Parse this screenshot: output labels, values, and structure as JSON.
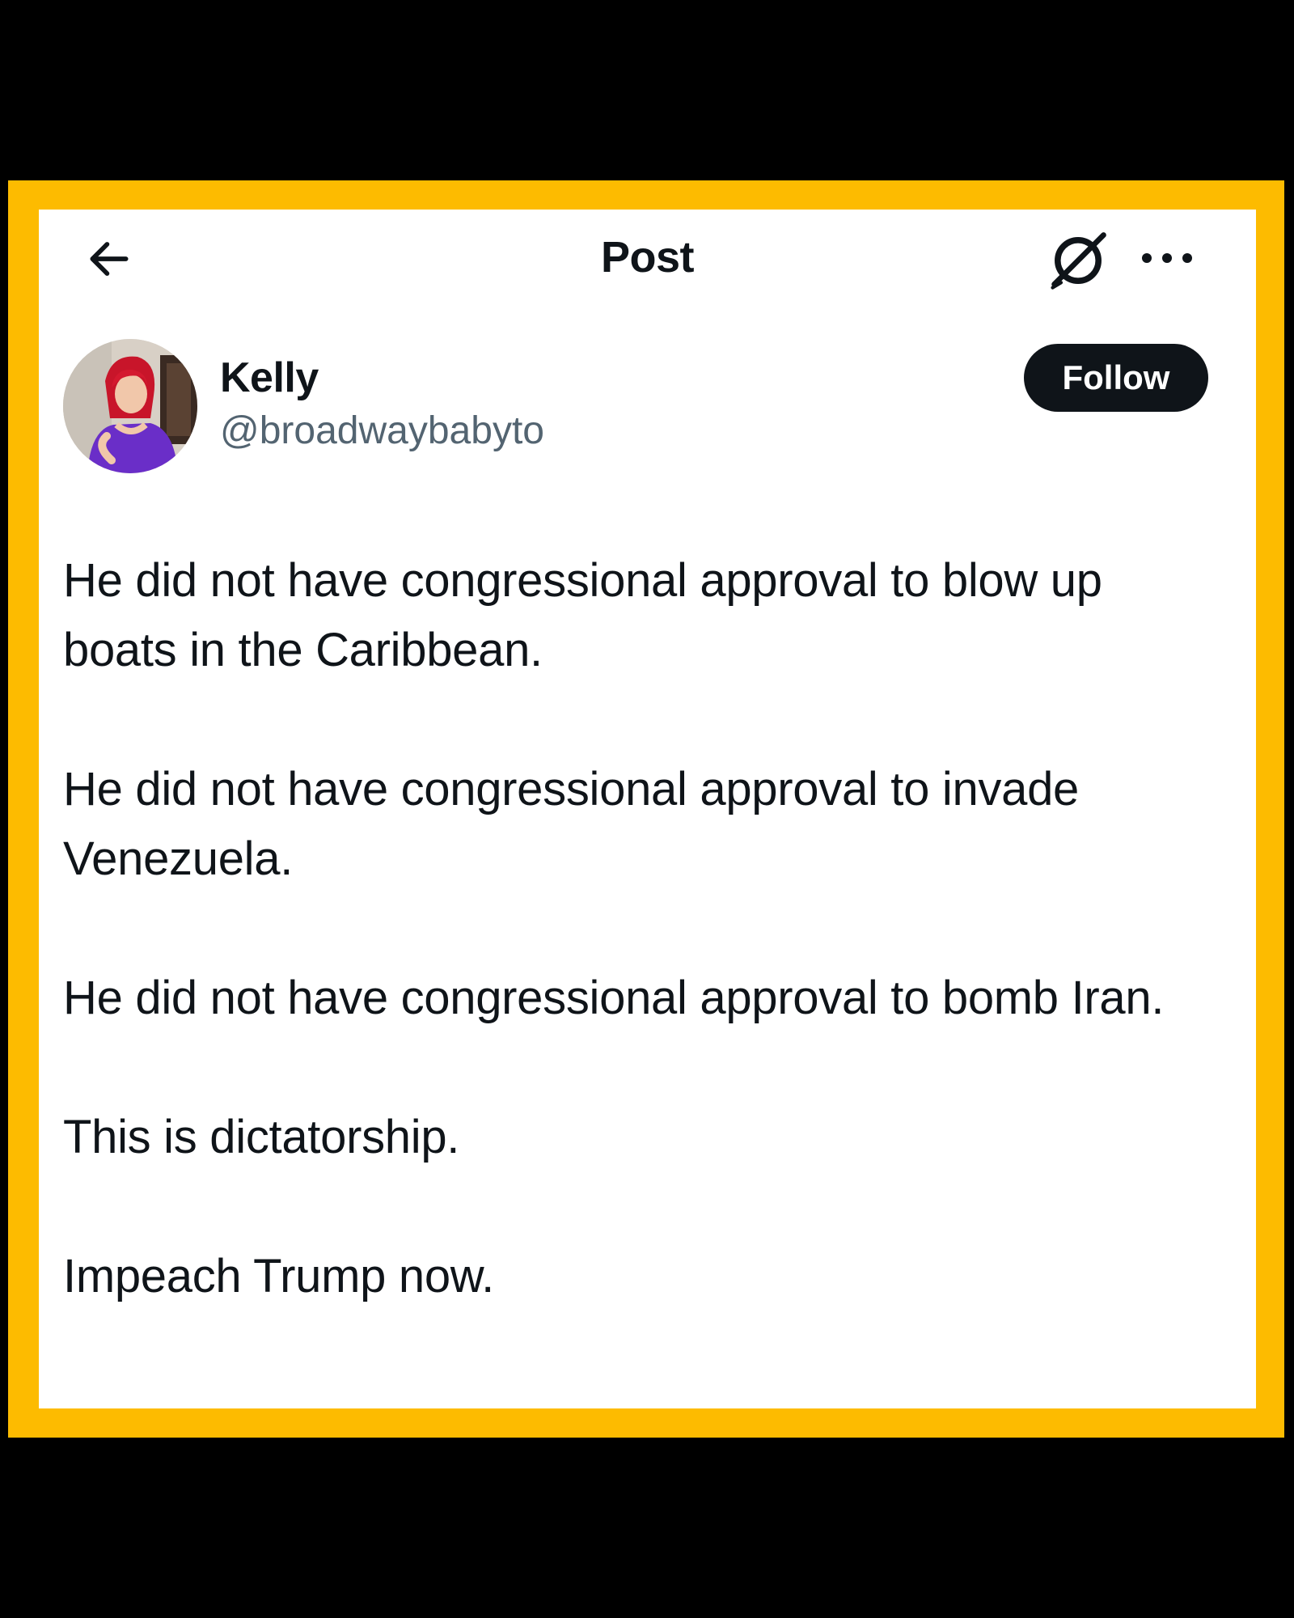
{
  "colors": {
    "outer_background": "#000000",
    "frame": "#FDBB00",
    "card": "#FFFFFF",
    "text": "#0f1419",
    "muted_text": "#536471",
    "follow_button": "#0f1419"
  },
  "topbar": {
    "back_icon": "arrow-left-icon",
    "title": "Post",
    "grok_icon": "grok-icon",
    "more_icon": "more-horizontal-icon"
  },
  "author": {
    "avatar": "avatar-photo",
    "name": "Kelly",
    "handle": "@broadwaybabyto",
    "follow_label": "Follow"
  },
  "post": {
    "paragraphs": [
      "He did not have congressional approval to blow up boats in the Caribbean.",
      "He did not have congressional approval to invade Venezuela.",
      "He did not have congressional approval to bomb Iran.",
      "This is dictatorship.",
      "Impeach Trump now."
    ]
  }
}
